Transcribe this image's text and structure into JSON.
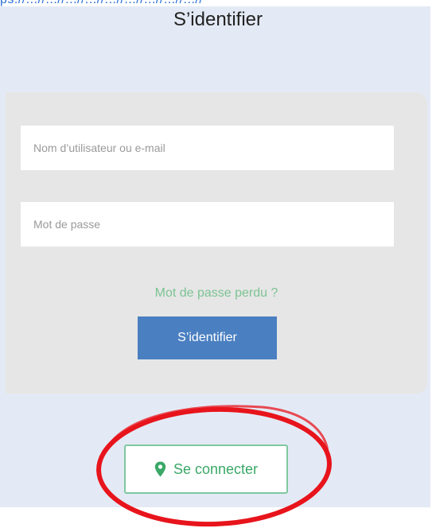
{
  "header": {
    "top_fragment": "ps://...//...//...//...//...//...//...//...//...//"
  },
  "login": {
    "title": "S’identifier",
    "username_placeholder": "Nom d’utilisateur ou e-mail",
    "password_placeholder": "Mot de passe",
    "forgot_password": "Mot de passe perdu ?",
    "submit_label": "S’identifier"
  },
  "connect": {
    "label": "Se connecter",
    "icon": "map-pin-icon"
  },
  "colors": {
    "backdrop": "#e4eaf5",
    "card": "#e6e6e6",
    "primary_button": "#4a7fc1",
    "link_green": "#7cc393",
    "connect_border": "#7fc8a0",
    "connect_text": "#3aa867",
    "annotation_red": "#e8141c"
  }
}
